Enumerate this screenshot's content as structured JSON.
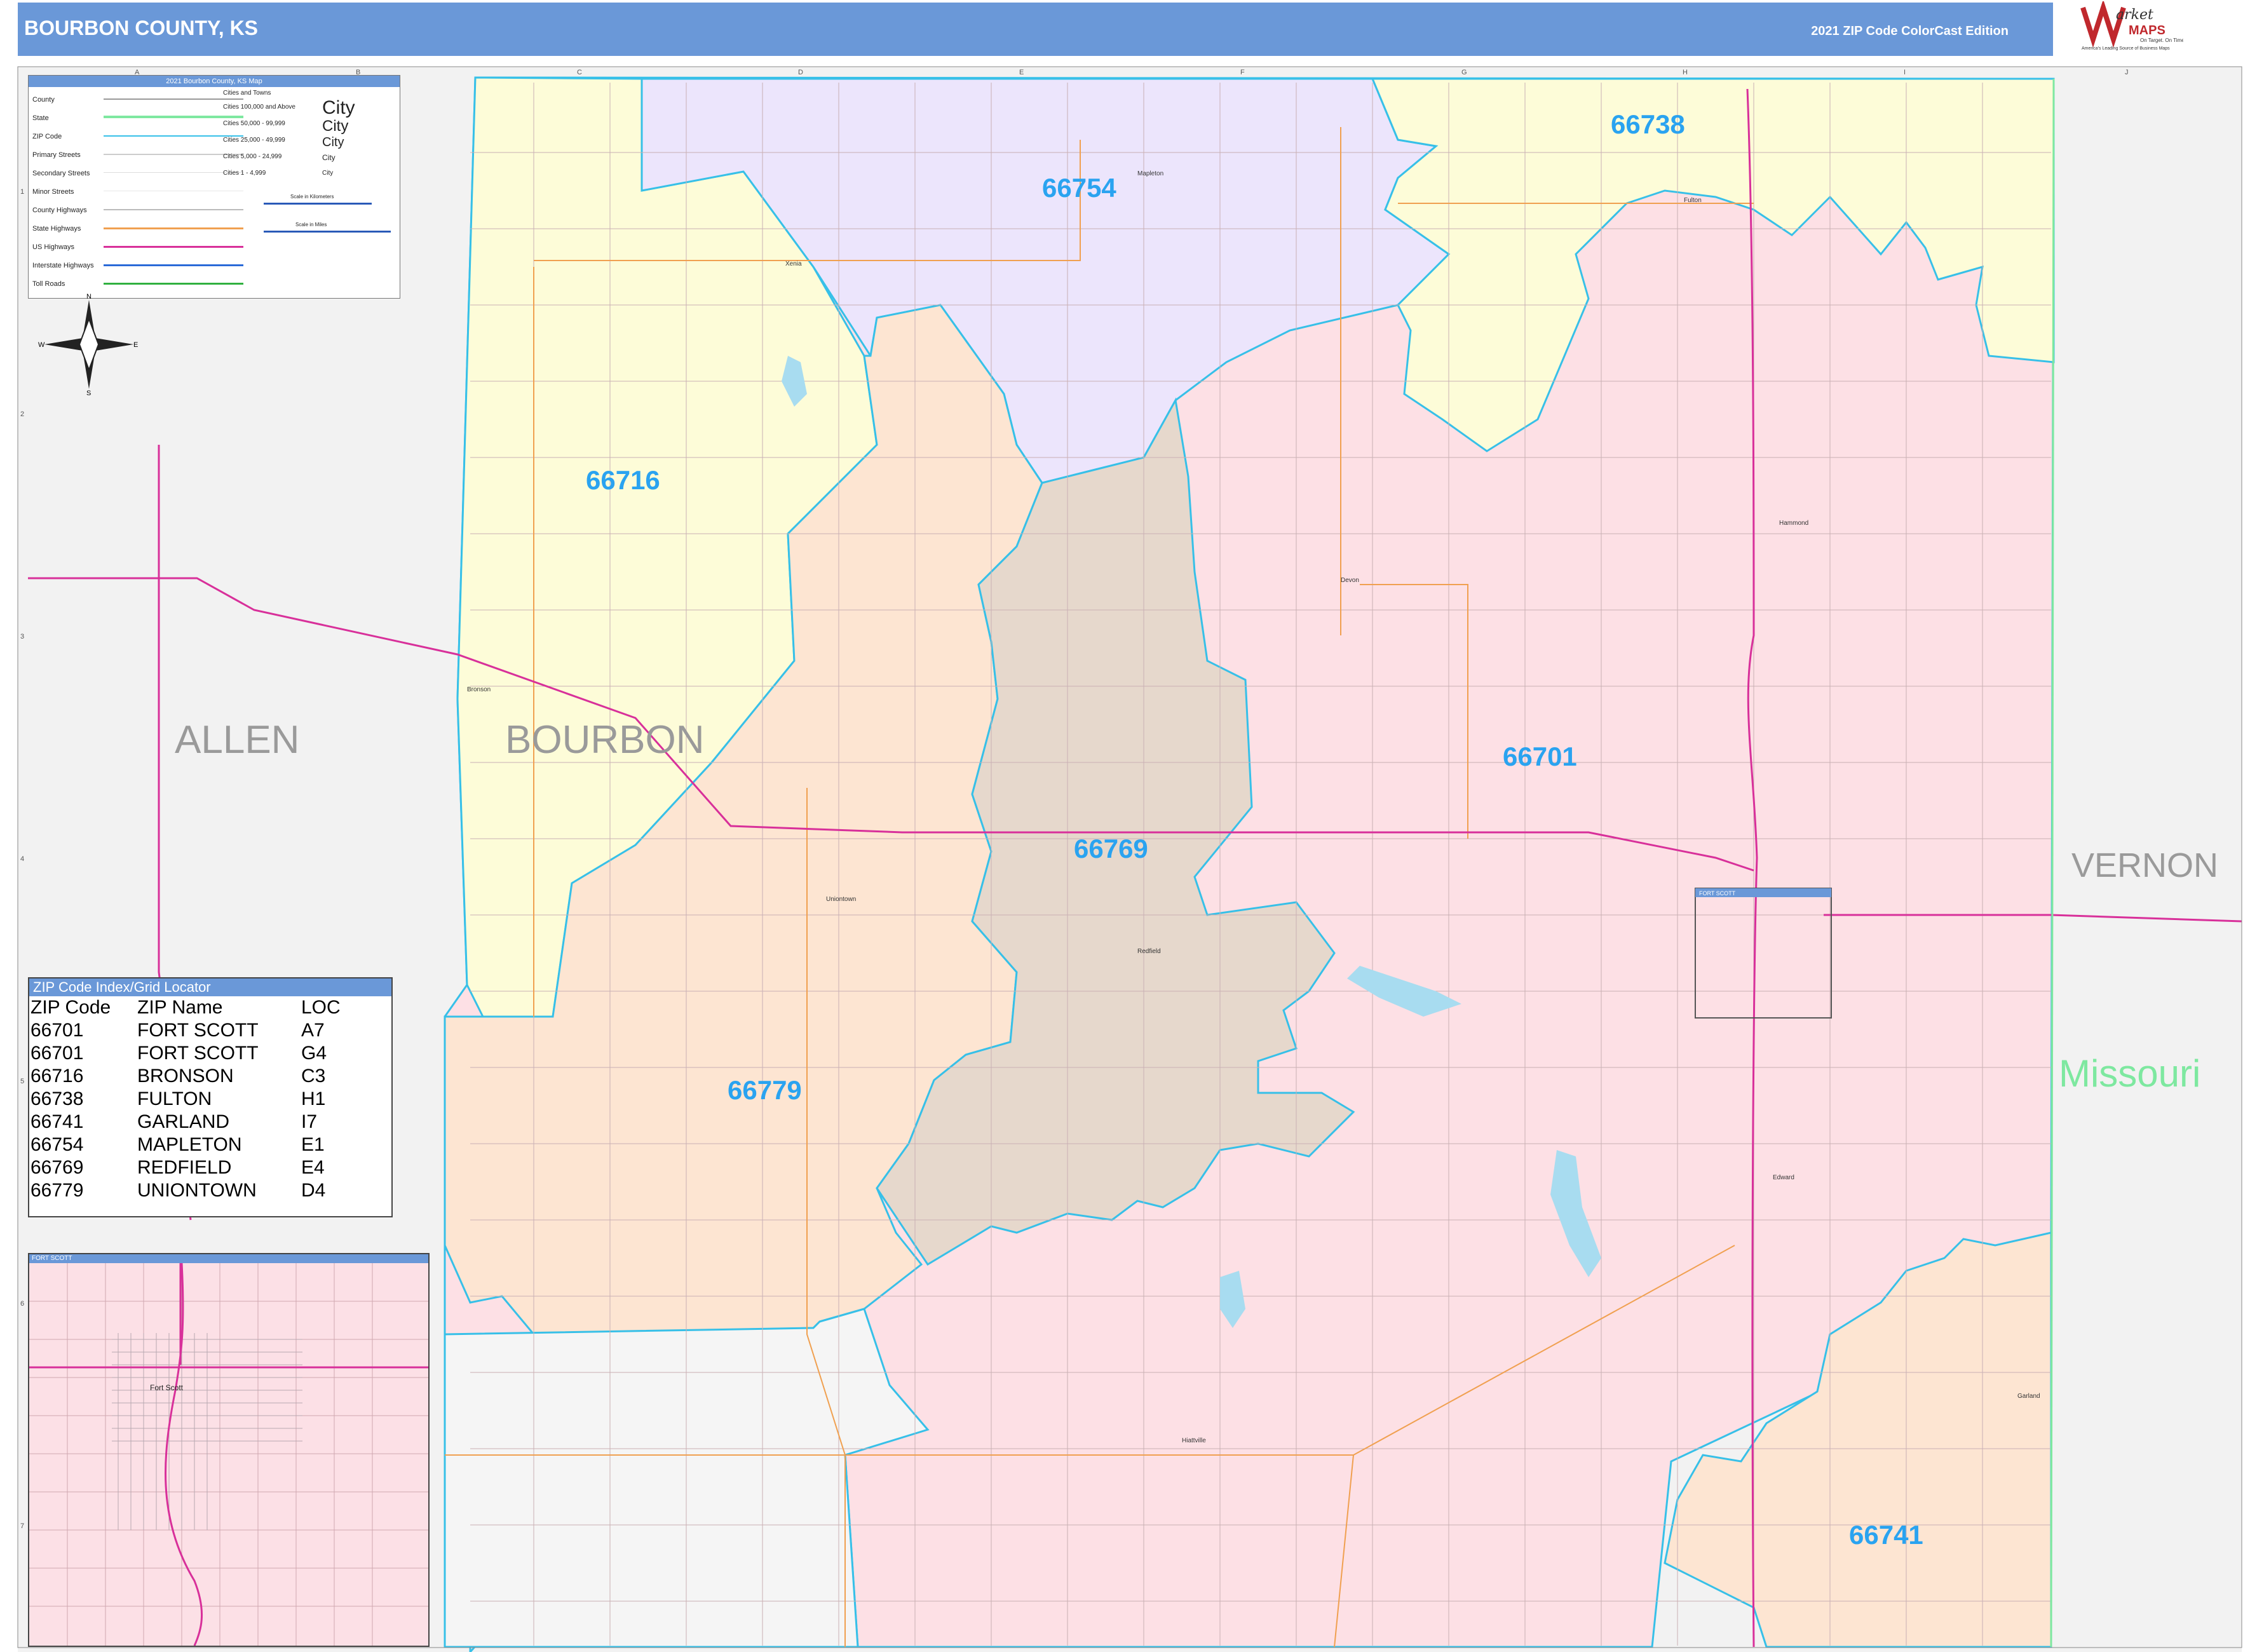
{
  "header": {
    "title": "BOURBON COUNTY, KS",
    "edition": "2021 ZIP Code ColorCast Edition",
    "logo_text_1": "arket",
    "logo_text_2": "MAPS",
    "logo_tagline": "On Target. On Time.",
    "logo_subtag": "America's Leading Source of Business Maps"
  },
  "legend": {
    "title": "2021 Bourbon County, KS Map",
    "items": [
      "County",
      "State",
      "ZIP Code",
      "Primary Streets",
      "Secondary Streets",
      "Minor Streets",
      "County Highways",
      "State Highways",
      "US Highways",
      "Interstate Highways",
      "Toll Roads"
    ],
    "cities_title": "Cities and Towns",
    "city_classes": [
      "Cities 100,000 and Above",
      "Cities 50,000 - 99,999",
      "Cities 25,000 - 49,999",
      "Cities 5,000 - 24,999",
      "Cities 1 - 4,999"
    ],
    "city_samples": [
      "City",
      "City",
      "City",
      "City",
      "City"
    ],
    "scale_km": "Scale in Kilometers",
    "scale_mi": "Scale in Miles"
  },
  "compass": {
    "n": "N",
    "s": "S",
    "e": "E",
    "w": "W"
  },
  "map": {
    "zips": [
      {
        "code": "66738",
        "color": "#fdfcd8"
      },
      {
        "code": "66754",
        "color": "#ece5fc"
      },
      {
        "code": "66716",
        "color": "#fdfcd8"
      },
      {
        "code": "66701",
        "color": "#fde0e5"
      },
      {
        "code": "66769",
        "color": "#e6d8cc"
      },
      {
        "code": "66779",
        "color": "#fde5d2"
      },
      {
        "code": "66741",
        "color": "#fde5d2"
      }
    ],
    "counties": [
      "ALLEN",
      "BOURBON",
      "VERNON"
    ],
    "state": "Missouri",
    "towns": [
      "Mapleton",
      "Fulton",
      "Xenia",
      "Hammond",
      "Devon",
      "Bronson",
      "Uniontown",
      "Redfield",
      "Fort Scott",
      "Edward",
      "Garland",
      "Hiattville"
    ],
    "fort_scott_label": "FORT SCOTT",
    "grid_cols": [
      "A",
      "B",
      "C",
      "D",
      "E",
      "F",
      "G",
      "H",
      "I",
      "J"
    ],
    "grid_rows": [
      "1",
      "2",
      "3",
      "4",
      "5",
      "6",
      "7"
    ]
  },
  "zip_index": {
    "title": "ZIP Code Index/Grid Locator",
    "headers": [
      "ZIP Code",
      "ZIP Name",
      "LOC"
    ],
    "rows": [
      [
        "66701",
        "FORT SCOTT",
        "A7"
      ],
      [
        "66701",
        "FORT SCOTT",
        "G4"
      ],
      [
        "66716",
        "BRONSON",
        "C3"
      ],
      [
        "66738",
        "FULTON",
        "H1"
      ],
      [
        "66741",
        "GARLAND",
        "I7"
      ],
      [
        "66754",
        "MAPLETON",
        "E1"
      ],
      [
        "66769",
        "REDFIELD",
        "E4"
      ],
      [
        "66779",
        "UNIONTOWN",
        "D4"
      ]
    ]
  },
  "inset": {
    "title": "FORT SCOTT",
    "town": "Fort Scott"
  }
}
